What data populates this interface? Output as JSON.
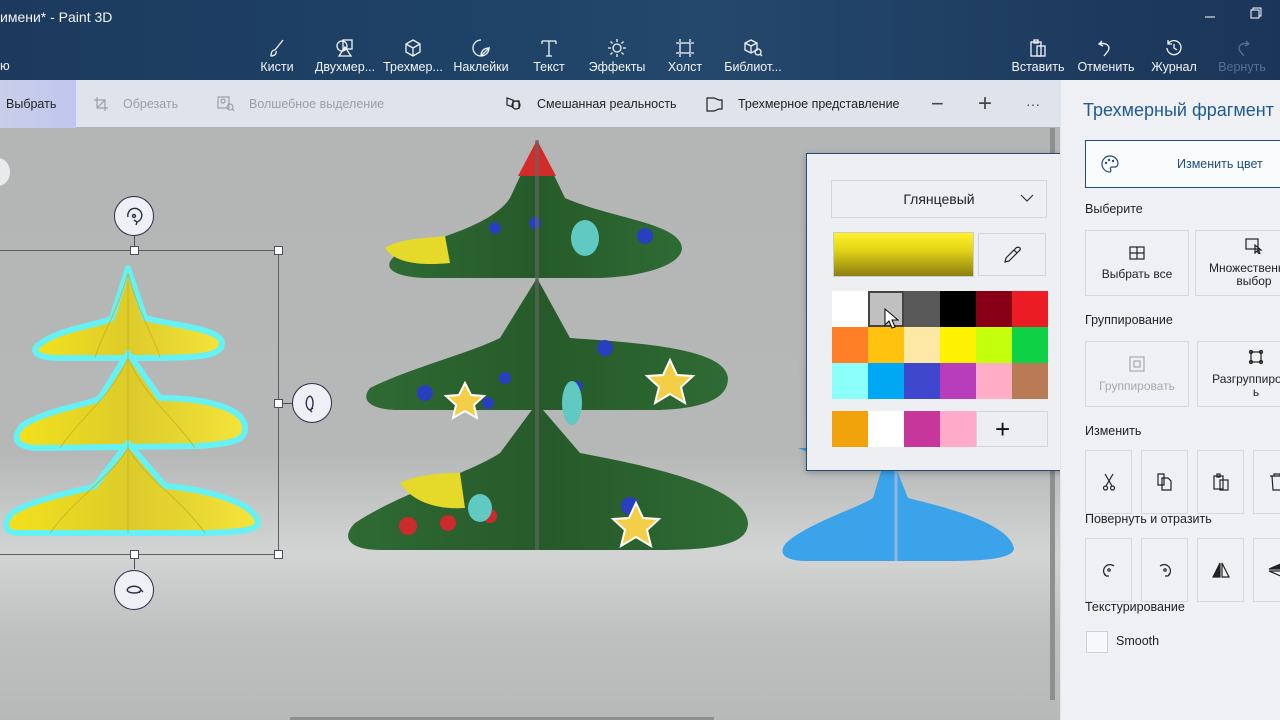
{
  "window": {
    "title": "имени* - Paint 3D",
    "menu_fragment": "ю",
    "minimize_icon": "minimize-icon",
    "restore_icon": "restore-icon"
  },
  "toolbar": {
    "tools": [
      {
        "label": "Кисти",
        "icon": "brush-icon"
      },
      {
        "label": "Двухмер...",
        "icon": "2d-shapes-icon"
      },
      {
        "label": "Трехмер...",
        "icon": "3d-shapes-icon"
      },
      {
        "label": "Наклейки",
        "icon": "stickers-icon"
      },
      {
        "label": "Текст",
        "icon": "text-icon"
      },
      {
        "label": "Эффекты",
        "icon": "effects-icon"
      },
      {
        "label": "Холст",
        "icon": "canvas-icon"
      },
      {
        "label": "Библиот...",
        "icon": "3d-library-icon"
      }
    ],
    "actions": [
      {
        "label": "Вставить",
        "icon": "paste-icon",
        "enabled": true
      },
      {
        "label": "Отменить",
        "icon": "undo-icon",
        "enabled": true
      },
      {
        "label": "Журнал",
        "icon": "history-icon",
        "enabled": true
      },
      {
        "label": "Вернуть",
        "icon": "redo-icon",
        "enabled": false
      }
    ]
  },
  "subtoolbar": {
    "select": "Выбрать",
    "crop": "Обрезать",
    "magic_select": "Волшебное выделение",
    "mixed_reality": "Смешанная реальность",
    "view_3d": "Трехмерное представление",
    "zoom_out": "−",
    "zoom_in": "+",
    "more": "···"
  },
  "color_picker": {
    "finish": "Глянцевый",
    "current_color": "#e2d416",
    "palette": [
      "#ffffff",
      "#c0c0c0",
      "#595959",
      "#000000",
      "#880015",
      "#ec1c24",
      "#ff7f27",
      "#ffc20e",
      "#fde8a6",
      "#fff200",
      "#c4ff0e",
      "#0ed145",
      "#8cfffb",
      "#00a8f3",
      "#3f48cc",
      "#b83dba",
      "#ffaec8",
      "#b97a56"
    ],
    "selected_index": 1,
    "custom_colors": [
      "#f0a30a",
      "#ffffff",
      "#c7379b",
      "#ffaac9"
    ],
    "add_color_label": "+"
  },
  "panel": {
    "title": "Трехмерный фрагмент",
    "change_color": "Изменить цвет",
    "select_label": "Выберите",
    "select_all": "Выбрать все",
    "multi_select": "Множественный выбор",
    "group_label": "Группирование",
    "group": "Группировать",
    "ungroup": "Разгруппировать",
    "edit_label": "Изменить",
    "rotate_label": "Повернуть и отразить",
    "texturing_label": "Текстурирование",
    "smooth_label": "Smooth",
    "smooth_checked": false
  }
}
